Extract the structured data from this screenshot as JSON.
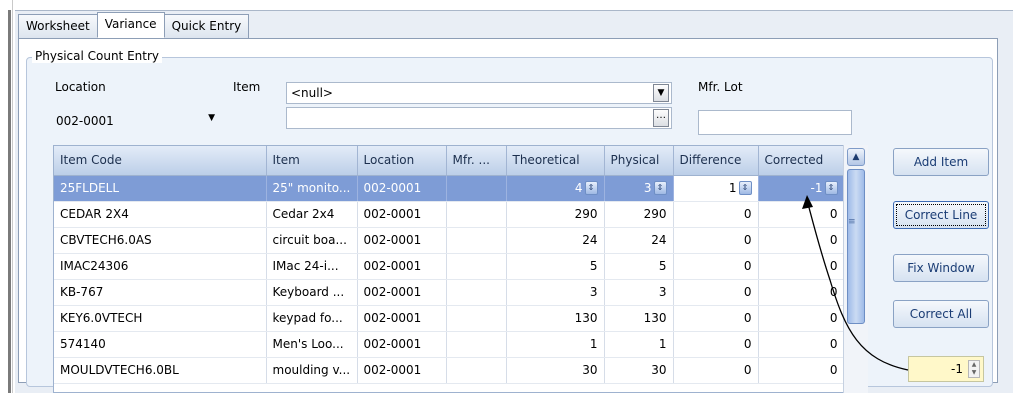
{
  "tabs": [
    {
      "label": "Worksheet"
    },
    {
      "label": "Variance"
    },
    {
      "label": "Quick Entry"
    }
  ],
  "active_tab": "Variance",
  "group_title": "Physical Count Entry",
  "fields": {
    "location_label": "Location",
    "location_value": "002-0001",
    "item_label": "Item",
    "item_value": "<null>",
    "item_secondary_value": "",
    "mfr_lot_label": "Mfr. Lot",
    "mfr_lot_value": ""
  },
  "grid": {
    "columns": [
      "Item Code",
      "Item",
      "Location",
      "Mfr. ...",
      "Theoretical",
      "Physical",
      "Difference",
      "Corrected"
    ],
    "rows": [
      {
        "code": "25FLDELL",
        "item": "25\" monito...",
        "location": "002-0001",
        "mfr": "",
        "theoretical": "4",
        "physical": "3",
        "difference": "1",
        "corrected": "-1"
      },
      {
        "code": "CEDAR 2X4",
        "item": "Cedar 2x4",
        "location": "002-0001",
        "mfr": "",
        "theoretical": "290",
        "physical": "290",
        "difference": "0",
        "corrected": "0"
      },
      {
        "code": "CBVTECH6.0AS",
        "item": "circuit boa...",
        "location": "002-0001",
        "mfr": "",
        "theoretical": "24",
        "physical": "24",
        "difference": "0",
        "corrected": "0"
      },
      {
        "code": "IMAC24306",
        "item": "IMac  24-i...",
        "location": "002-0001",
        "mfr": "",
        "theoretical": "5",
        "physical": "5",
        "difference": "0",
        "corrected": "0"
      },
      {
        "code": "KB-767",
        "item": "Keyboard ...",
        "location": "002-0001",
        "mfr": "",
        "theoretical": "3",
        "physical": "3",
        "difference": "0",
        "corrected": "0"
      },
      {
        "code": "KEY6.0VTECH",
        "item": "keypad fo...",
        "location": "002-0001",
        "mfr": "",
        "theoretical": "130",
        "physical": "130",
        "difference": "0",
        "corrected": "0"
      },
      {
        "code": "574140",
        "item": "Men's Loo...",
        "location": "002-0001",
        "mfr": "",
        "theoretical": "1",
        "physical": "1",
        "difference": "0",
        "corrected": "0"
      },
      {
        "code": "MOULDVTECH6.0BL",
        "item": "moulding v...",
        "location": "002-0001",
        "mfr": "",
        "theoretical": "30",
        "physical": "30",
        "difference": "0",
        "corrected": "0"
      }
    ]
  },
  "buttons": {
    "add_item": "Add Item",
    "correct_line": "Correct Line",
    "fix_window": "Fix Window",
    "correct_all": "Correct All"
  },
  "correction_value": "-1",
  "icons": {
    "dropdown": "chevron-down-icon",
    "ellipsis": "ellipsis-icon",
    "spin": "spin-icon",
    "scroll_up": "chevron-up-icon"
  },
  "colors": {
    "selected_row": "#7e9cd6",
    "highlight_box": "#fff8c9",
    "button_text": "#1a3c74"
  }
}
